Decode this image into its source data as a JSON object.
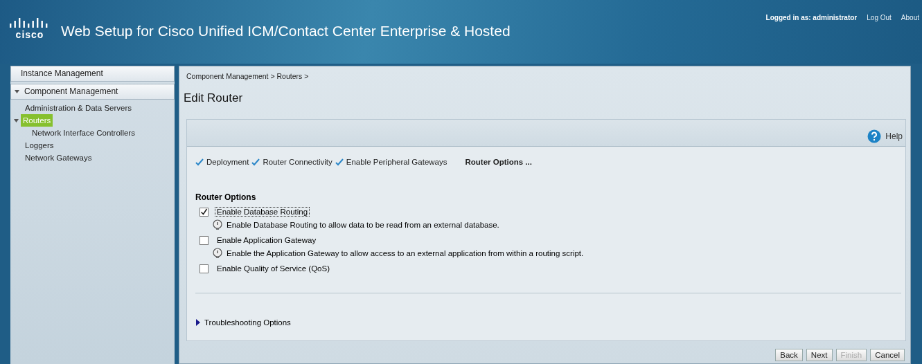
{
  "header": {
    "logo_text": "cisco",
    "title": "Web Setup for Cisco Unified ICM/Contact Center Enterprise & Hosted",
    "user_label": "Logged in as: administrator",
    "links": [
      "Log Out",
      "About"
    ]
  },
  "sidebar": {
    "sections": [
      {
        "label": "Instance Management",
        "expanded": false
      },
      {
        "label": "Component Management",
        "expanded": true,
        "children": [
          {
            "label": "Administration & Data Servers",
            "selected": false
          },
          {
            "label": "Routers",
            "selected": true,
            "expanded": true,
            "children": [
              {
                "label": "Network Interface Controllers",
                "selected": false
              }
            ]
          },
          {
            "label": "Loggers",
            "selected": false
          },
          {
            "label": "Network Gateways",
            "selected": false
          }
        ]
      }
    ]
  },
  "main": {
    "breadcrumb": "Component Management > Routers >",
    "title": "Edit Router",
    "help": "Help",
    "steps": [
      {
        "label": "Deployment",
        "done": true
      },
      {
        "label": "Router Connectivity",
        "done": true
      },
      {
        "label": "Enable Peripheral Gateways",
        "done": true
      },
      {
        "label": "Router Options ...",
        "done": false
      }
    ],
    "section_title": "Router Options",
    "options": [
      {
        "label": "Enable Database Routing",
        "checked": true,
        "focused": true,
        "hint": "Enable Database Routing to allow data to be read from an external database."
      },
      {
        "label": "Enable Application Gateway",
        "checked": false,
        "focused": false,
        "hint": "Enable the Application Gateway to allow access to an external application from within a routing script."
      },
      {
        "label": "Enable Quality of Service (QoS)",
        "checked": false,
        "focused": false
      }
    ],
    "troubleshooting": {
      "label": "Troubleshooting Options",
      "expanded": false
    },
    "buttons": [
      {
        "label": "Back",
        "disabled": false
      },
      {
        "label": "Next",
        "disabled": false
      },
      {
        "label": "Finish",
        "disabled": true
      },
      {
        "label": "Cancel",
        "disabled": false
      }
    ]
  }
}
